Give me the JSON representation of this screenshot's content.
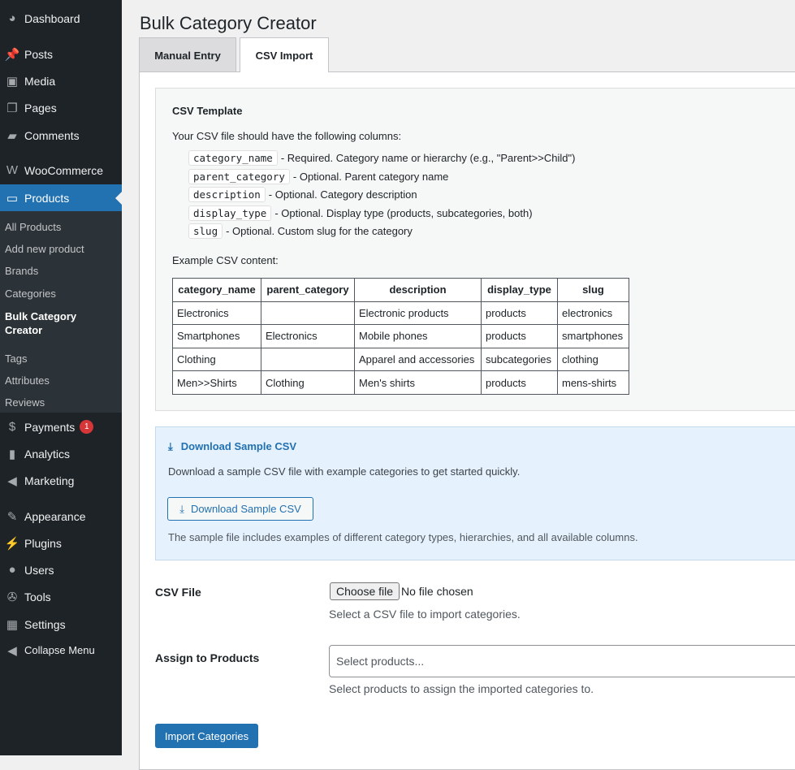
{
  "sidebar": {
    "items": [
      {
        "label": "Dashboard",
        "icon": "dashboard-icon"
      },
      {
        "label": "Posts",
        "icon": "pin-icon"
      },
      {
        "label": "Media",
        "icon": "media-icon"
      },
      {
        "label": "Pages",
        "icon": "pages-icon"
      },
      {
        "label": "Comments",
        "icon": "comment-icon"
      },
      {
        "label": "WooCommerce",
        "icon": "woo-icon"
      },
      {
        "label": "Products",
        "icon": "archive-icon"
      },
      {
        "label": "Payments",
        "icon": "dollar-icon",
        "badge": "1"
      },
      {
        "label": "Analytics",
        "icon": "bar-chart-icon"
      },
      {
        "label": "Marketing",
        "icon": "megaphone-icon"
      },
      {
        "label": "Appearance",
        "icon": "brush-icon"
      },
      {
        "label": "Plugins",
        "icon": "plugin-icon"
      },
      {
        "label": "Users",
        "icon": "user-icon"
      },
      {
        "label": "Tools",
        "icon": "wrench-icon"
      },
      {
        "label": "Settings",
        "icon": "settings-icon"
      },
      {
        "label": "Collapse Menu",
        "icon": "collapse-icon"
      }
    ],
    "submenu": [
      "All Products",
      "Add new product",
      "Brands",
      "Categories",
      "Bulk Category Creator",
      "Tags",
      "Attributes",
      "Reviews"
    ]
  },
  "page": {
    "title": "Bulk Category Creator",
    "tabs": [
      "Manual Entry",
      "CSV Import"
    ]
  },
  "template": {
    "heading": "CSV Template",
    "intro": "Your CSV file should have the following columns:",
    "columns": [
      {
        "code": "category_name",
        "desc": "- Required. Category name or hierarchy (e.g., \"Parent>>Child\")"
      },
      {
        "code": "parent_category",
        "desc": "- Optional. Parent category name"
      },
      {
        "code": "description",
        "desc": "- Optional. Category description"
      },
      {
        "code": "display_type",
        "desc": "- Optional. Display type (products, subcategories, both)"
      },
      {
        "code": "slug",
        "desc": "- Optional. Custom slug for the category"
      }
    ],
    "example_label": "Example CSV content:",
    "table": {
      "headers": [
        "category_name",
        "parent_category",
        "description",
        "display_type",
        "slug"
      ],
      "rows": [
        [
          "Electronics",
          "",
          "Electronic products",
          "products",
          "electronics"
        ],
        [
          "Smartphones",
          "Electronics",
          "Mobile phones",
          "products",
          "smartphones"
        ],
        [
          "Clothing",
          "",
          "Apparel and accessories",
          "subcategories",
          "clothing"
        ],
        [
          "Men>>Shirts",
          "Clothing",
          "Men's shirts",
          "products",
          "mens-shirts"
        ]
      ]
    }
  },
  "download": {
    "heading": "Download Sample CSV",
    "text": "Download a sample CSV file with example categories to get started quickly.",
    "button": "Download Sample CSV",
    "note": "The sample file includes examples of different category types, hierarchies, and all available columns."
  },
  "form": {
    "csv_label": "CSV File",
    "choose": "Choose file",
    "no_file": "No file chosen",
    "csv_help": "Select a CSV file to import categories.",
    "assign_label": "Assign to Products",
    "assign_placeholder": "Select products...",
    "assign_help": "Select products to assign the imported categories to.",
    "submit": "Import Categories"
  }
}
